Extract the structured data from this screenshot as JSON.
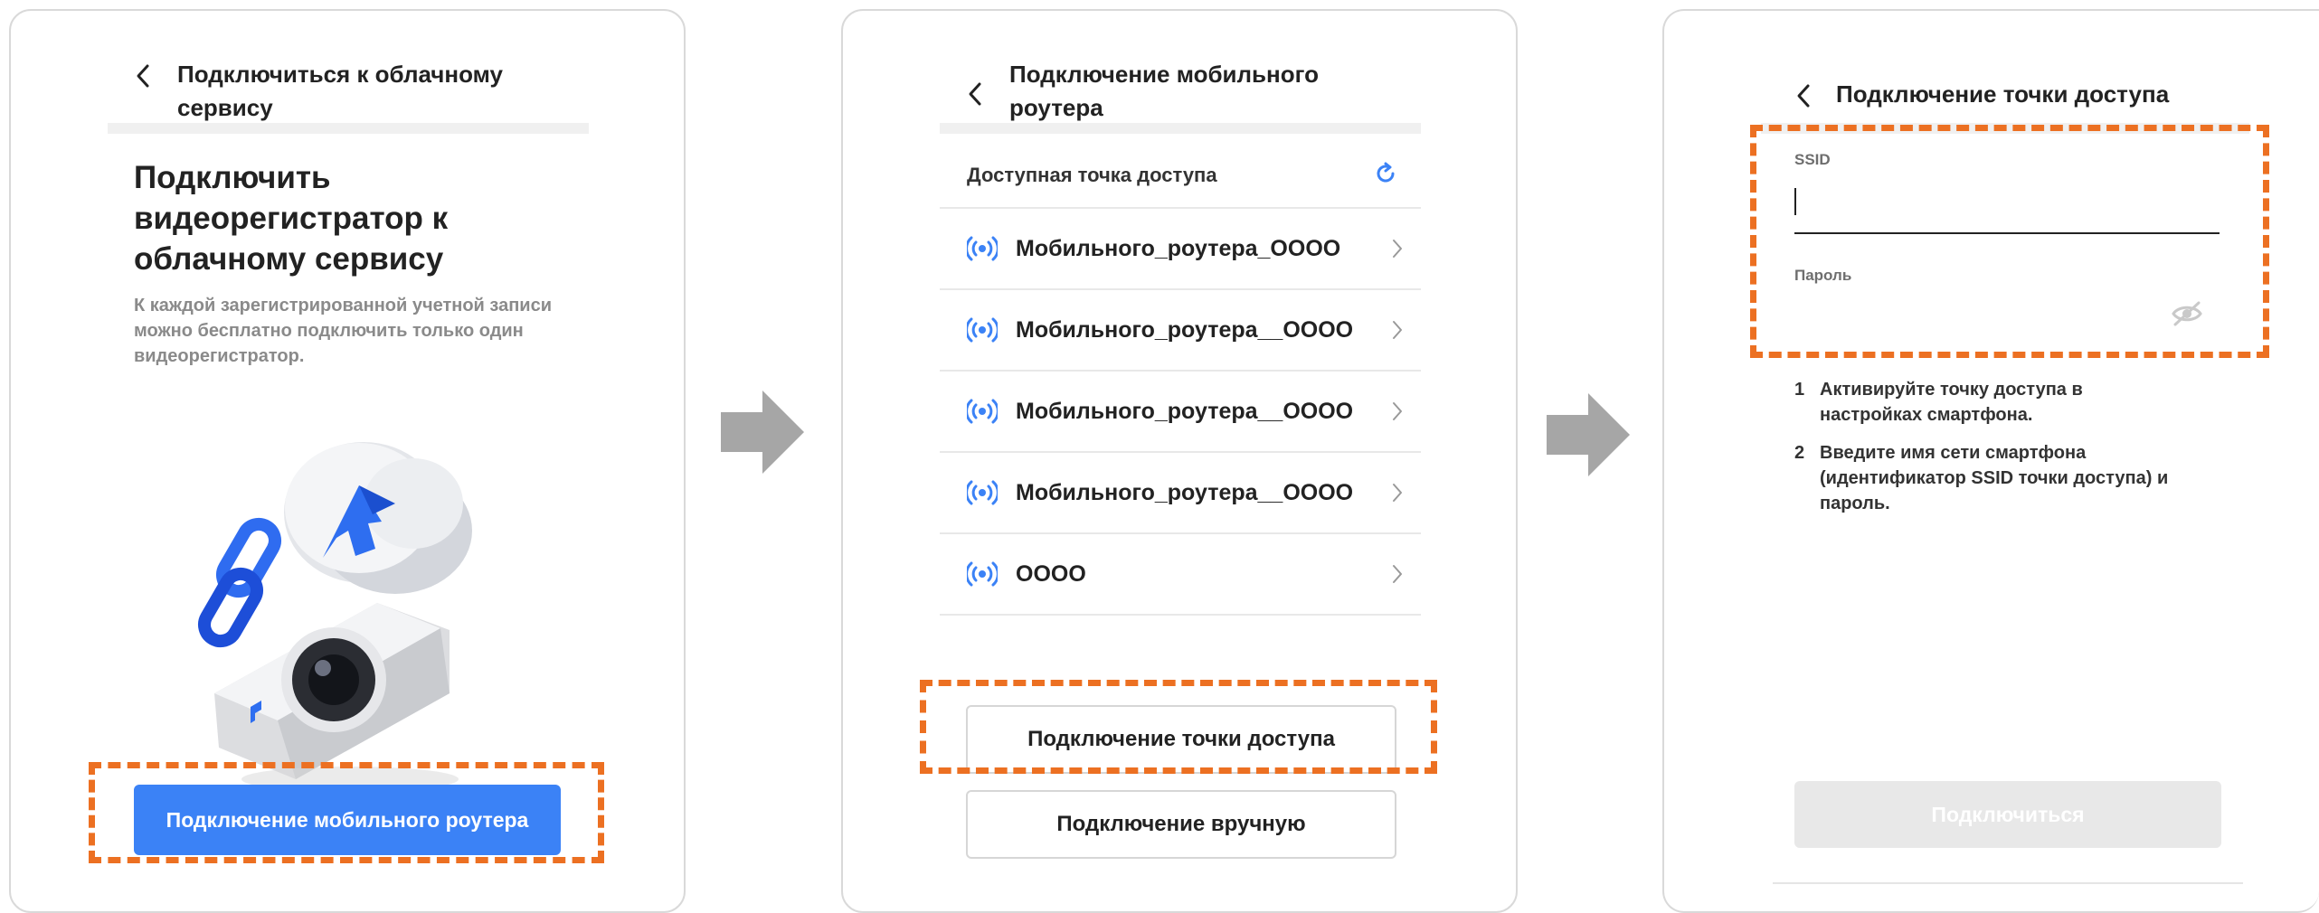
{
  "colors": {
    "accent": "#3b82f6",
    "highlight": "#ec7022",
    "arrow": "#a6a6a6",
    "disabled": "#e8e8e8"
  },
  "screen1": {
    "header_title": "Подключиться к облачному сервису",
    "title": "Подключить видеорегистратор к облачному сервису",
    "description": "К каждой зарегистрированной учетной записи можно бесплатно подключить только один видеорегистратор.",
    "primary_button": "Подключение мобильного роутера"
  },
  "screen2": {
    "header_title": "Подключение мобильного роутера",
    "available_label": "Доступная точка доступа",
    "refresh_icon": "refresh-icon",
    "networks": [
      {
        "name": "Мобильного_роутера_OOOO"
      },
      {
        "name": "Мобильного_роутера__OOOO"
      },
      {
        "name": "Мобильного_роутера__OOOO"
      },
      {
        "name": "Мобильного_роутера__OOOO"
      },
      {
        "name": "OOOO"
      }
    ],
    "hotspot_button": "Подключение точки доступа",
    "manual_button": "Подключение вручную"
  },
  "screen3": {
    "header_title": "Подключение точки доступа",
    "ssid_label": "SSID",
    "ssid_value": "",
    "password_label": "Пароль",
    "password_value": "",
    "steps": [
      {
        "num": "1",
        "text": "Активируйте точку доступа в настройках смартфона."
      },
      {
        "num": "2",
        "text": "Введите имя сети смартфона (идентификатор SSID точки доступа) и пароль."
      }
    ],
    "connect_button": "Подключиться"
  }
}
